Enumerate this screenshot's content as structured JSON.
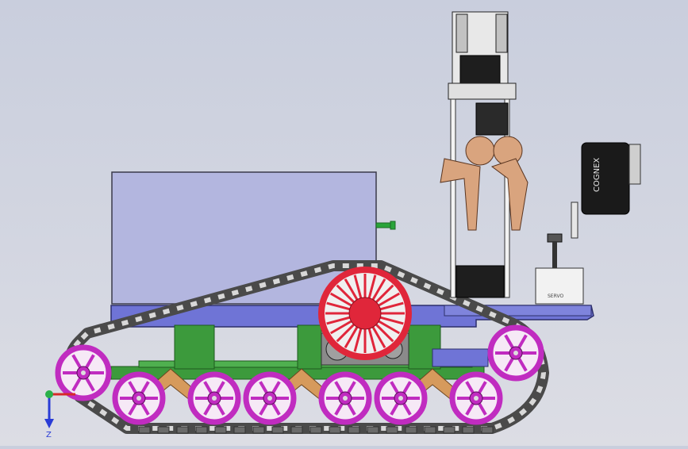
{
  "scene": {
    "camera_label": "COGNEX",
    "servo_label": "SERVO",
    "triad_label": "Z"
  },
  "colors": {
    "background": "#cfd3df",
    "box": "#b3b6df",
    "chassis": "#6f74d6",
    "rail": "#3c9a3c",
    "wheel": "#c02cc0",
    "linkage": "#d69a5c",
    "drive_red": "#e0263a",
    "track": "#5a5a5a",
    "gripper": "#d9a47e"
  }
}
